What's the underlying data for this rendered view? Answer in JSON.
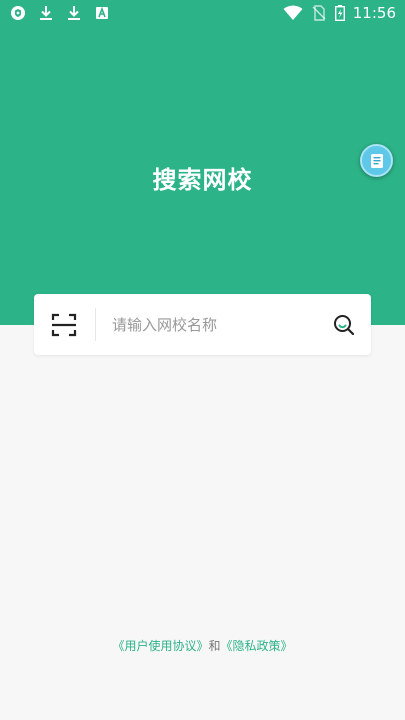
{
  "status_bar": {
    "time": "11:56",
    "left_icons": [
      "shield-icon",
      "download-icon",
      "download-icon",
      "font-a-icon"
    ],
    "right_icons": [
      "wifi-icon",
      "no-sim-icon",
      "battery-charging-icon"
    ]
  },
  "header": {
    "title": "搜索网校",
    "background_color": "#2db388"
  },
  "floating_button": {
    "icon": "document-icon"
  },
  "search": {
    "placeholder": "请输入网校名称",
    "value": "",
    "scan_icon": "scan-icon",
    "search_icon": "search-icon"
  },
  "footer": {
    "user_agreement": "《用户使用协议》",
    "connector": "和",
    "privacy_policy": "《隐私政策》"
  }
}
